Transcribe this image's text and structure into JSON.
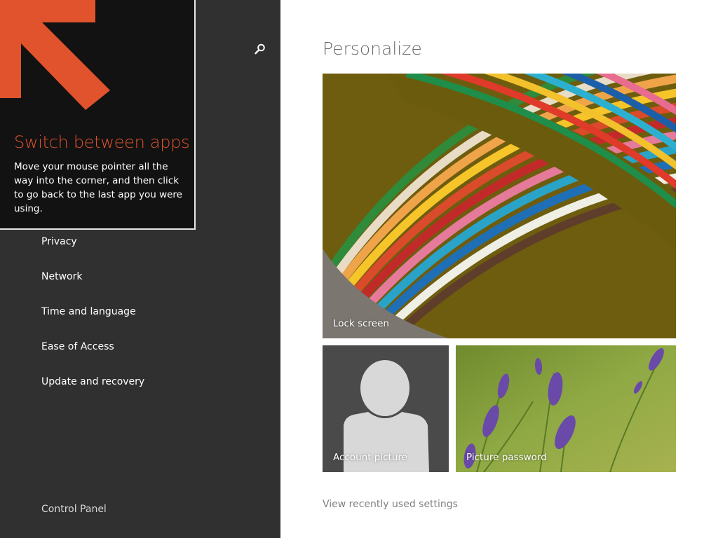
{
  "sidebar": {
    "search_icon": "search-icon",
    "items": [
      {
        "label": "Privacy"
      },
      {
        "label": "Network"
      },
      {
        "label": "Time and language"
      },
      {
        "label": "Ease of Access"
      },
      {
        "label": "Update and recovery"
      }
    ],
    "control_panel": "Control Panel"
  },
  "tip": {
    "title": "Switch between apps",
    "body": "Move your mouse pointer all the way into the corner, and then click to go back to the last app you were using.",
    "arrow_icon": "arrow-up-left-icon",
    "accent_color": "#e0532c"
  },
  "main": {
    "title": "Personalize",
    "tiles": {
      "lock_screen": "Lock screen",
      "account_picture": "Account picture",
      "picture_password": "Picture password"
    },
    "recent_settings_link": "View recently used settings"
  },
  "colors": {
    "sidebar_bg": "#303030",
    "tip_bg": "#121212",
    "accent": "#e0532c",
    "page_bg": "#ffffff"
  }
}
